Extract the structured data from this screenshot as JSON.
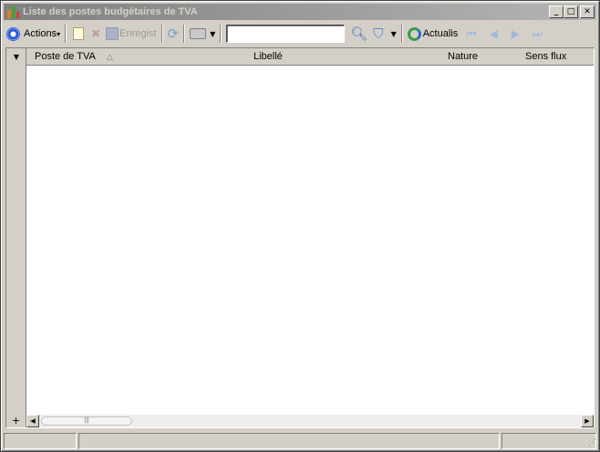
{
  "window": {
    "title": "Liste des postes budgétaires de TVA",
    "minimize": "_",
    "maximize": "□",
    "close": "✕"
  },
  "toolbar": {
    "actions_label": "Actions",
    "save_label": "Enregist",
    "search_value": "",
    "refresh_label": "Actualis",
    "icons": [
      "actions-icon",
      "new-icon",
      "delete-icon",
      "save-icon",
      "refresh-icon",
      "print-icon",
      "search-icon",
      "filter-icon",
      "refresh-data-icon",
      "first-icon",
      "previous-icon",
      "next-icon",
      "last-icon"
    ]
  },
  "grid": {
    "columns": [
      {
        "label": "Poste de TVA",
        "sorted": "ascending"
      },
      {
        "label": "Libellé"
      },
      {
        "label": "Nature"
      },
      {
        "label": "Sens flux"
      }
    ],
    "rows": [],
    "add_row": "+"
  },
  "colors": {
    "chrome": "#d4d0c8",
    "title_gradient_start": "#808080",
    "title_gradient_end": "#b5b5b5",
    "accent": "#2a5bd7"
  }
}
